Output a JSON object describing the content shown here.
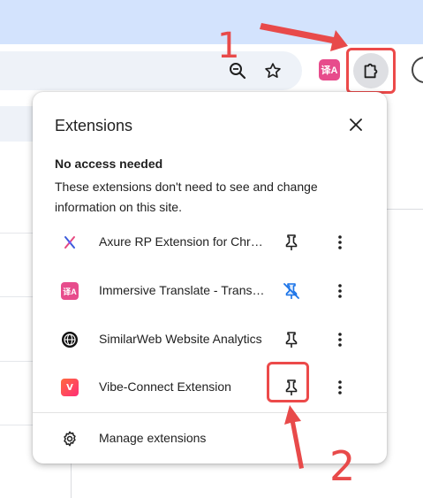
{
  "toolbar": {
    "translate_icon_text": "译A"
  },
  "annotations": {
    "step1": "1",
    "step2": "2",
    "color": "#e84a4a"
  },
  "popup": {
    "title": "Extensions",
    "close_icon": "close-icon",
    "section_heading": "No access needed",
    "section_description": "These extensions don't need to see and change information on this site.",
    "extensions": [
      {
        "name": "Axure RP Extension for Chrome",
        "icon": "axure-logo",
        "pinned": false,
        "pin_style": "outline"
      },
      {
        "name": "Immersive Translate - Translate Website & PDF",
        "icon": "immersive-translate-logo",
        "pinned": true,
        "pin_style": "blue-crossed"
      },
      {
        "name": "SimilarWeb Website Analytics",
        "icon": "globe-logo",
        "pinned": false,
        "pin_style": "outline"
      },
      {
        "name": "Vibe-Connect Extension",
        "icon": "vibe-connect-logo",
        "pinned": false,
        "pin_style": "outline"
      }
    ],
    "manage_label": "Manage extensions",
    "accent_color": "#1a73e8"
  }
}
